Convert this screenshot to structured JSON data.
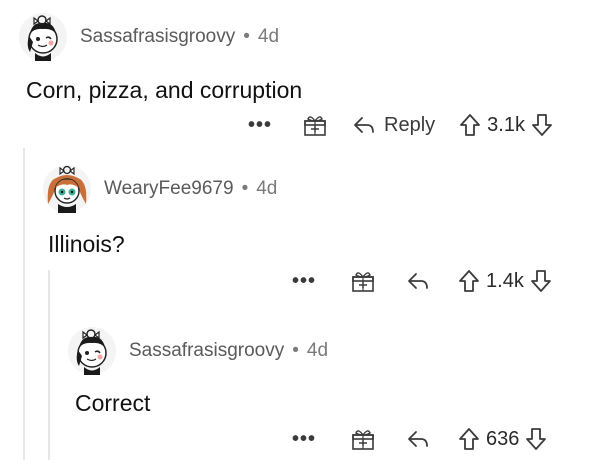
{
  "comments": [
    {
      "author": "Sassafrasisgroovy",
      "separator": "•",
      "age": "4d",
      "text": "Corn, pizza, and corruption",
      "reply_label": "Reply",
      "score": "3.1k",
      "avatar": "avatar-snoo-ribbon"
    },
    {
      "author": "WearyFee9679",
      "separator": "•",
      "age": "4d",
      "text": "Illinois?",
      "reply_label": "",
      "score": "1.4k",
      "avatar": "avatar-snoo-redhair"
    },
    {
      "author": "Sassafrasisgroovy",
      "separator": "•",
      "age": "4d",
      "text": "Correct",
      "reply_label": "",
      "score": "636",
      "avatar": "avatar-snoo-ribbon"
    }
  ],
  "more_label": "•••",
  "colors": {
    "text": "#1c1c1c",
    "meta": "#7a7a7a",
    "thread": "#e6e6e6",
    "icon": "#3b3b3b"
  }
}
